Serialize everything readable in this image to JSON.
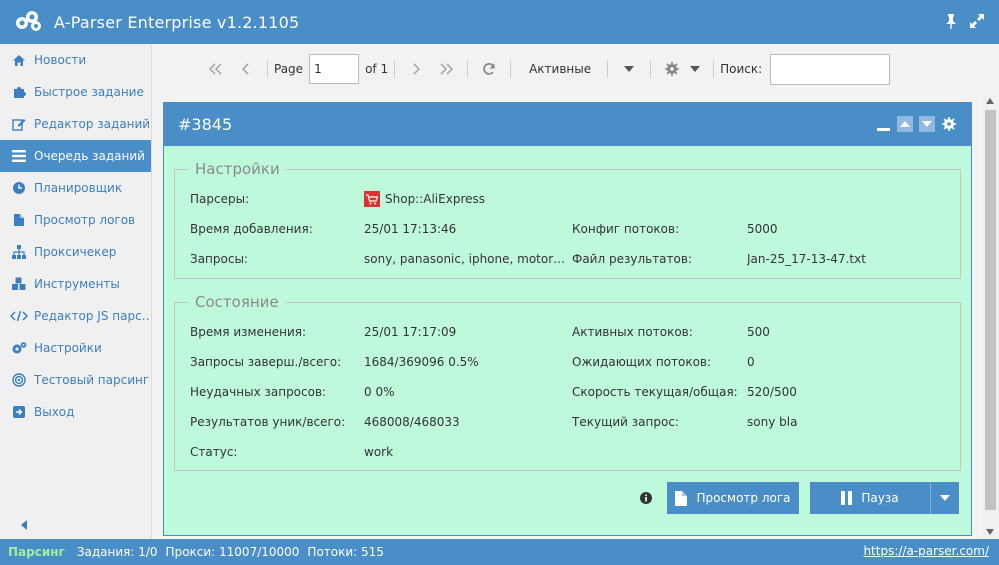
{
  "app": {
    "title": "A-Parser Enterprise v1.2.1105"
  },
  "sidebar": {
    "items": [
      {
        "label": "Новости",
        "icon": "home-icon"
      },
      {
        "label": "Быстрое задание",
        "icon": "puzzle-icon"
      },
      {
        "label": "Редактор заданий",
        "icon": "edit-icon"
      },
      {
        "label": "Очередь заданий",
        "icon": "list-icon",
        "active": true
      },
      {
        "label": "Планировщик",
        "icon": "clock-icon"
      },
      {
        "label": "Просмотр логов",
        "icon": "file-icon"
      },
      {
        "label": "Проксичекер",
        "icon": "sitemap-icon"
      },
      {
        "label": "Инструменты",
        "icon": "cubes-icon"
      },
      {
        "label": "Редактор JS парс…",
        "icon": "code-icon"
      },
      {
        "label": "Настройки",
        "icon": "gears-icon"
      },
      {
        "label": "Тестовый парсинг",
        "icon": "target-icon"
      },
      {
        "label": "Выход",
        "icon": "exit-icon"
      }
    ]
  },
  "toolbar": {
    "page_label": "Page",
    "page_value": "1",
    "of_label": "of 1",
    "filter_label": "Активные",
    "search_label": "Поиск:",
    "search_value": ""
  },
  "panel": {
    "title": "#3845",
    "settings_legend": "Настройки",
    "settings": {
      "parsers_label": "Парсеры:",
      "parsers_value": "Shop::AliExpress",
      "added_label": "Время добавления:",
      "added_value": "25/01 17:13:46",
      "threads_config_label": "Конфиг потоков:",
      "threads_config_value": "5000",
      "queries_label": "Запросы:",
      "queries_value": "sony, panasonic, iphone, motor…",
      "results_file_label": "Файл результатов:",
      "results_file_value": "Jan-25_17-13-47.txt"
    },
    "state_legend": "Состояние",
    "state": {
      "changed_label": "Время изменения:",
      "changed_value": "25/01 17:17:09",
      "active_threads_label": "Активных потоков:",
      "active_threads_value": "500",
      "queries_done_label": "Запросы заверш./всего:",
      "queries_done_value": "1684/369096 0.5%",
      "waiting_threads_label": "Ожидающих потоков:",
      "waiting_threads_value": "0",
      "failed_label": "Неудачных запросов:",
      "failed_value": "0 0%",
      "speed_label": "Скорость текущая/общая:",
      "speed_value": "520/500",
      "results_label": "Результатов уник/всего:",
      "results_value": "468008/468033",
      "current_query_label": "Текущий запрос:",
      "current_query_value": "sony bla",
      "status_label": "Статус:",
      "status_value": "work"
    },
    "buttons": {
      "view_log": "Просмотр лога",
      "pause": "Пауза"
    }
  },
  "statusbar": {
    "mode": "Парсинг",
    "tasks": "Задания: 1/0",
    "proxies": "Прокси: 11007/10000",
    "threads": "Потоки: 515",
    "link": "https://a-parser.com/"
  },
  "colors": {
    "accent": "#4a8ec8",
    "panel_bg": "#bff9dc",
    "status_green": "#9ef09e"
  }
}
